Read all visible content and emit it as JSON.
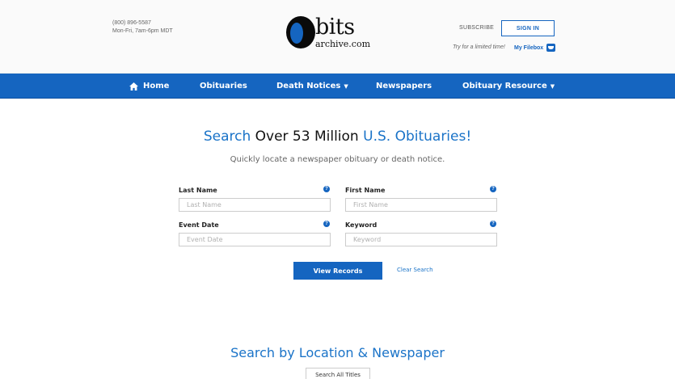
{
  "header": {
    "phone": "(800) 896-5587",
    "hours": "Mon-Fri, 7am-6pm MDT",
    "logo_bits": "bits",
    "logo_archive": "archive.com",
    "subscribe_label": "SUBSCRIBE",
    "signin_label": "SIGN IN",
    "tagline": "Try for a limited time!",
    "filebox_label": "My Filebox"
  },
  "nav": {
    "items": [
      {
        "label": "Home",
        "icon": "home-icon"
      },
      {
        "label": "Obituaries"
      },
      {
        "label": "Death Notices",
        "dropdown": true
      },
      {
        "label": "Newspapers"
      },
      {
        "label": "Obituary Resource",
        "dropdown": true
      }
    ]
  },
  "search": {
    "headline_part1": "Search",
    "headline_part2": "Over 53 Million",
    "headline_part3": "U.S. Obituaries!",
    "subline": "Quickly locate a newspaper obituary or death notice.",
    "fields": {
      "last_name": {
        "label": "Last Name",
        "placeholder": "Last Name",
        "value": ""
      },
      "first_name": {
        "label": "First Name",
        "placeholder": "First Name",
        "value": ""
      },
      "event_date": {
        "label": "Event Date",
        "placeholder": "Event Date",
        "value": ""
      },
      "keyword": {
        "label": "Keyword",
        "placeholder": "Keyword",
        "value": ""
      }
    },
    "help_glyph": "?",
    "view_label": "View Records",
    "clear_label": "Clear Search"
  },
  "location": {
    "heading": "Search by Location & Newspaper",
    "all_titles_label": "Search All Titles"
  },
  "colors": {
    "brand_blue": "#1565c0",
    "link_blue": "#1a73c8"
  }
}
